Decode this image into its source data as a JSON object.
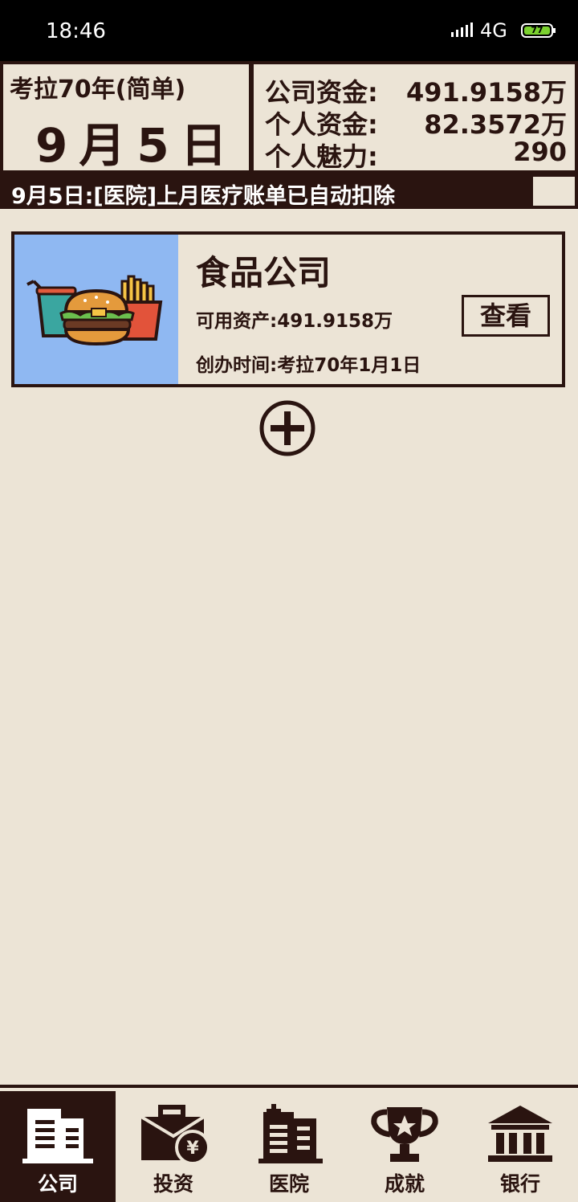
{
  "status_bar": {
    "time": "18:46",
    "network": "4G",
    "battery": "77"
  },
  "header": {
    "year": "考拉70年(简单)",
    "month_day": "9月5日",
    "company_funds_label": "公司资金:",
    "company_funds_value": "491.9158万",
    "personal_funds_label": "个人资金:",
    "personal_funds_value": "82.3572万",
    "charm_label": "个人魅力:",
    "charm_value": "290"
  },
  "ticker": {
    "message": "9月5日:[医院]上月医疗账单已自动扣除"
  },
  "companies": [
    {
      "name": "食品公司",
      "assets": "可用资产:491.9158万",
      "founded": "创办时间:考拉70年1月1日",
      "view_label": "查看",
      "icon": "burger-fries-drink-icon"
    }
  ],
  "tabs": [
    {
      "label": "公司",
      "icon": "building-icon",
      "active": true
    },
    {
      "label": "投资",
      "icon": "briefcase-yen-icon",
      "active": false
    },
    {
      "label": "医院",
      "icon": "hospital-icon",
      "active": false
    },
    {
      "label": "成就",
      "icon": "trophy-icon",
      "active": false
    },
    {
      "label": "银行",
      "icon": "bank-icon",
      "active": false
    }
  ],
  "colors": {
    "ink": "#2a1410",
    "paper": "#ece4d6",
    "card_image_bg": "#8fb8f2"
  }
}
